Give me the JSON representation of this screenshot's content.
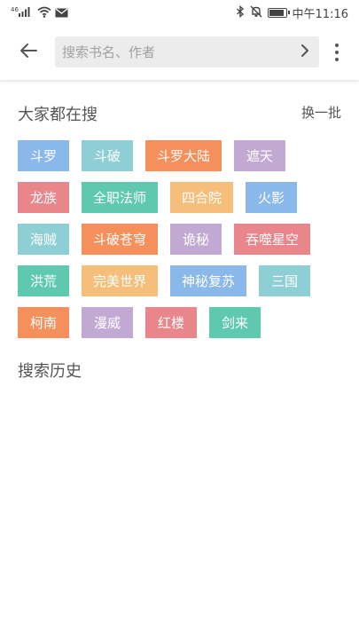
{
  "status_bar": {
    "time": "中午11:16",
    "icons": [
      "signal-icon",
      "wifi-icon",
      "mail-icon",
      "bluetooth-icon",
      "mute-icon",
      "battery-icon"
    ]
  },
  "toolbar": {
    "back_icon": "arrow-left-icon",
    "search_placeholder": "搜索书名、作者",
    "search_value": "",
    "go_icon": "chevron-right-icon",
    "more_icon": "more-vertical-icon"
  },
  "hot": {
    "title": "大家都在搜",
    "refresh_label": "换一批",
    "tags": [
      {
        "label": "斗罗",
        "color": "#8ab8ea"
      },
      {
        "label": "斗破",
        "color": "#8ecfd6"
      },
      {
        "label": "斗罗大陆",
        "color": "#f5905c"
      },
      {
        "label": "遮天",
        "color": "#c2a9d3"
      },
      {
        "label": "龙族",
        "color": "#e8868c"
      },
      {
        "label": "全职法师",
        "color": "#5fc9b0"
      },
      {
        "label": "四合院",
        "color": "#f5be7a"
      },
      {
        "label": "火影",
        "color": "#8ab8ea"
      },
      {
        "label": "海贼",
        "color": "#8ecfd6"
      },
      {
        "label": "斗破苍穹",
        "color": "#f5905c"
      },
      {
        "label": "诡秘",
        "color": "#c2a9d3"
      },
      {
        "label": "吞噬星空",
        "color": "#e8868c"
      },
      {
        "label": "洪荒",
        "color": "#5fc9b0"
      },
      {
        "label": "完美世界",
        "color": "#f5be7a"
      },
      {
        "label": "神秘复苏",
        "color": "#8ab8ea"
      },
      {
        "label": "三国",
        "color": "#8ecfd6"
      },
      {
        "label": "柯南",
        "color": "#f5905c"
      },
      {
        "label": "漫威",
        "color": "#c2a9d3"
      },
      {
        "label": "红楼",
        "color": "#e8868c"
      },
      {
        "label": "剑来",
        "color": "#5fc9b0"
      }
    ]
  },
  "history": {
    "title": "搜索历史"
  }
}
